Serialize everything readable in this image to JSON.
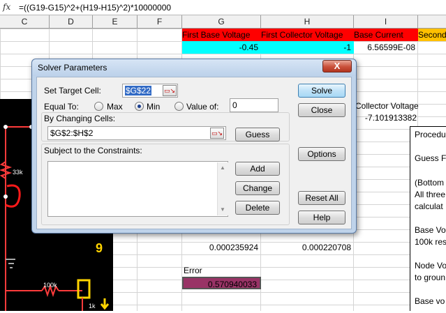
{
  "formula_bar": {
    "fx_icon": "fx",
    "formula": "=((G19-G15)^2+(H19-H15)^2)*10000000"
  },
  "columns": [
    "C",
    "D",
    "E",
    "F",
    "G",
    "H",
    "I"
  ],
  "headers_row": {
    "g": "First Base Voltage",
    "h": "First Collector Voltage",
    "i": "Base Current",
    "j": "Second"
  },
  "values_row": {
    "g": "-0.45",
    "h": "-1",
    "i": "6.56599E-08"
  },
  "cells": {
    "collector_voltage_label": "Collector Voltage",
    "collector_voltage_value": "-7.101913382",
    "g_small": "0.000235924",
    "h_small": "0.000220708",
    "error_label": "Error",
    "error_value": "0.570940033"
  },
  "circuit": {
    "r1_label": "33k",
    "r2_label": "100k",
    "r3_label": "1k",
    "mark_9": "9",
    "colors": {
      "wire": "#ff3b3b",
      "marker": "#ffd400"
    }
  },
  "notes": {
    "line1": "Procedu",
    "line2": "Guess F",
    "line3": "(Bottom",
    "line4": "All three",
    "line5": "calculat",
    "line6": "Base Vo",
    "line7": "100k res",
    "line8": "Node Vo",
    "line9": "to groun",
    "line10": "Base vo"
  },
  "dialog": {
    "title": "Solver Parameters",
    "close_label": "X",
    "set_target_label": "Set Target Cell:",
    "target_value": "$G$22",
    "equal_to_label": "Equal To:",
    "max_label": "Max",
    "min_label": "Min",
    "value_of_label": "Value of:",
    "value_of_value": "0",
    "changing_cells_label": "By Changing Cells:",
    "changing_cells_value": "$G$2:$H$2",
    "constraints_label": "Subject to the Constraints:",
    "buttons": {
      "solve": "Solve",
      "close": "Close",
      "guess": "Guess",
      "options": "Options",
      "add": "Add",
      "change": "Change",
      "delete": "Delete",
      "reset_all": "Reset All",
      "help": "Help"
    }
  }
}
